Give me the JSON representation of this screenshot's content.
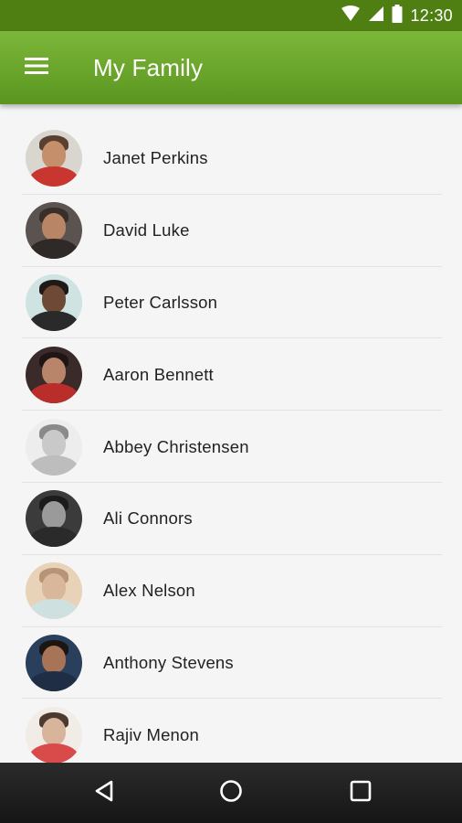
{
  "status_bar": {
    "time": "12:30",
    "icons": [
      "wifi-icon",
      "signal-icon",
      "battery-icon"
    ]
  },
  "app_bar": {
    "title": "My Family",
    "menu_icon": "hamburger-menu-icon",
    "color": "#6aa52b"
  },
  "contacts": [
    {
      "name": "Janet Perkins",
      "avatar": {
        "bg": "#d9d5cf",
        "skin": "#c48f6a",
        "hair": "#5a4030",
        "shirt": "#c9362f"
      }
    },
    {
      "name": "David Luke",
      "avatar": {
        "bg": "#5b5350",
        "skin": "#b88567",
        "hair": "#3a2e2a",
        "shirt": "#2f2a28"
      }
    },
    {
      "name": "Peter Carlsson",
      "avatar": {
        "bg": "#cfe3e2",
        "skin": "#6e4a36",
        "hair": "#1f1a18",
        "shirt": "#2a2a2a"
      }
    },
    {
      "name": "Aaron Bennett",
      "avatar": {
        "bg": "#3a2a2a",
        "skin": "#b9856a",
        "hair": "#1e1614",
        "shirt": "#b92d2a"
      }
    },
    {
      "name": "Abbey Christensen",
      "avatar": {
        "bg": "#ededed",
        "skin": "#c9c9c9",
        "hair": "#8a8a8a",
        "shirt": "#bdbdbd"
      }
    },
    {
      "name": "Ali Connors",
      "avatar": {
        "bg": "#3b3b3b",
        "skin": "#9a9a9a",
        "hair": "#1c1c1c",
        "shirt": "#2a2a2a"
      }
    },
    {
      "name": "Alex Nelson",
      "avatar": {
        "bg": "#e8d2b8",
        "skin": "#d8b79a",
        "hair": "#b89476",
        "shirt": "#cfe0e0"
      }
    },
    {
      "name": "Anthony Stevens",
      "avatar": {
        "bg": "#2a3f5c",
        "skin": "#a87457",
        "hair": "#1b1612",
        "shirt": "#1f2e45"
      }
    },
    {
      "name": "Rajiv Menon",
      "avatar": {
        "bg": "#f1ece6",
        "skin": "#d8b49a",
        "hair": "#4a3a30",
        "shirt": "#d94a4a"
      }
    }
  ],
  "nav_bar": {
    "back_icon": "back-triangle-icon",
    "home_icon": "home-circle-icon",
    "recents_icon": "recents-square-icon"
  }
}
